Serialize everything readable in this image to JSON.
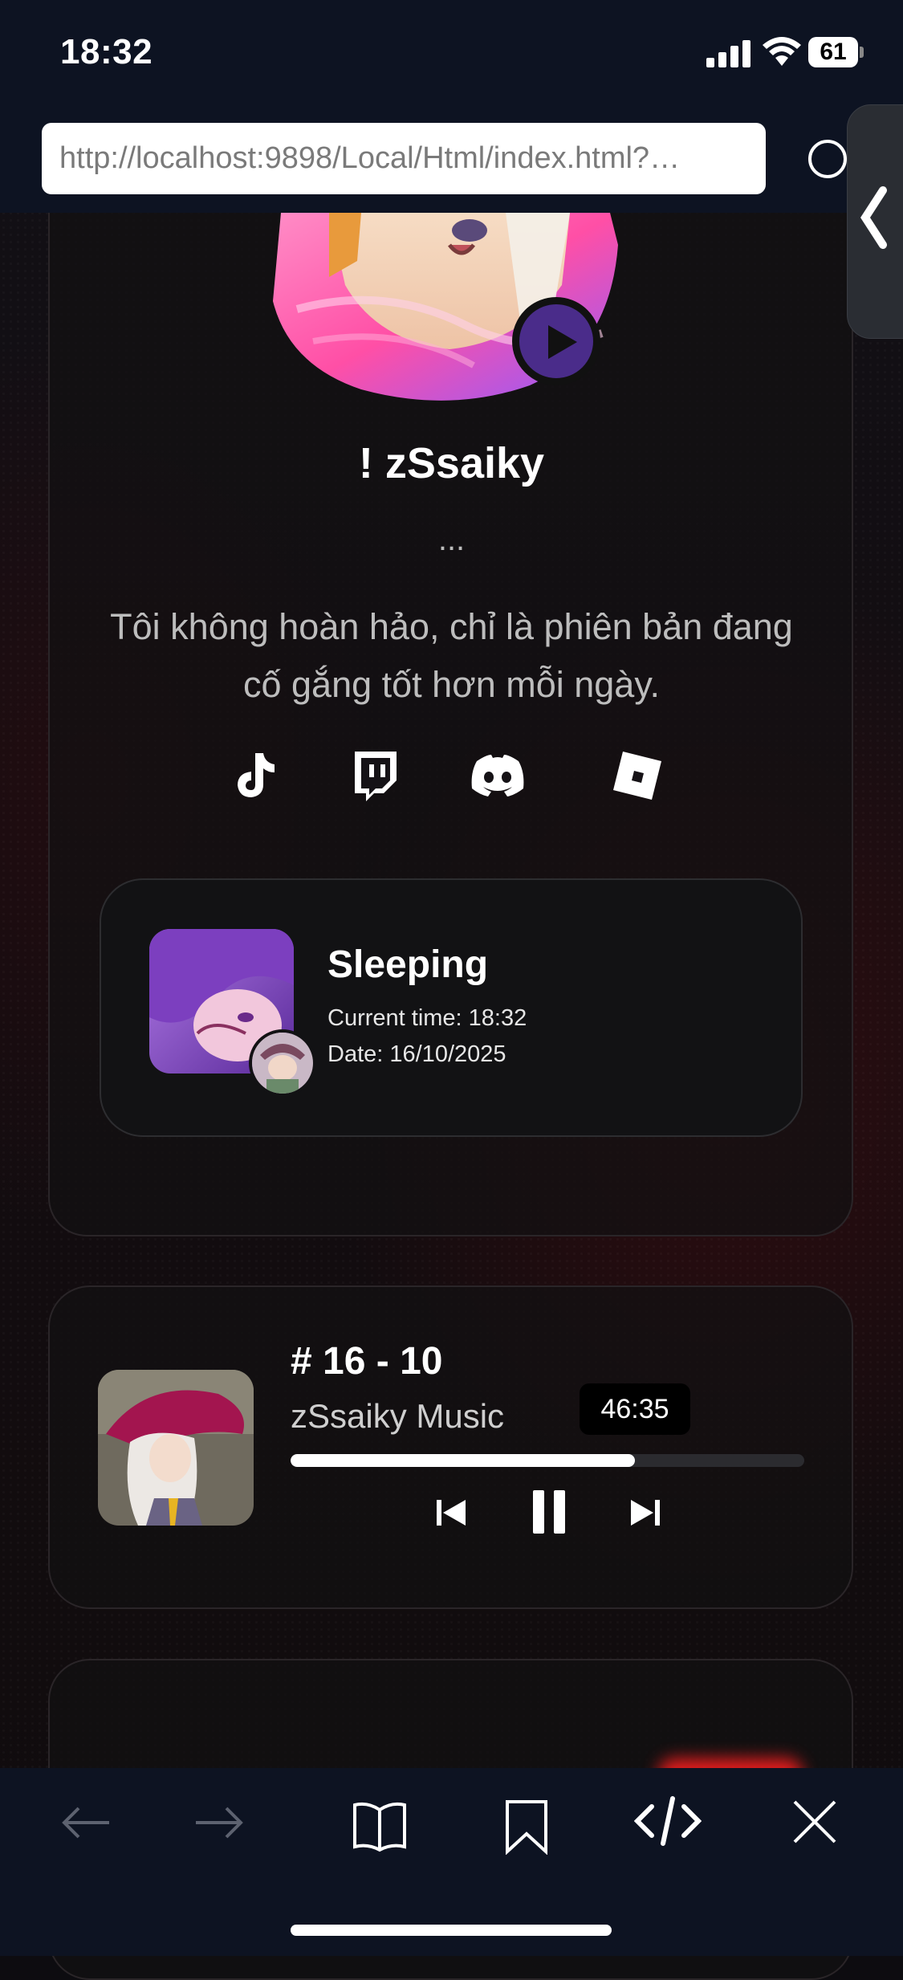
{
  "status_bar": {
    "time": "18:32",
    "battery": "61"
  },
  "browser": {
    "url": "http://localhost:9898/Local/Html/index.html?…"
  },
  "profile": {
    "name": "! zSsaiky",
    "ellipsis": "...",
    "bio": "Tôi không hoàn hảo, chỉ là phiên bản đang cố gắng tốt hơn mỗi ngày.",
    "socials": [
      "tiktok-icon",
      "twitch-icon",
      "discord-icon",
      "roblox-icon"
    ]
  },
  "status_card": {
    "title": "Sleeping",
    "current_time": "Current time: 18:32",
    "date": "Date: 16/10/2025"
  },
  "music": {
    "title": "# 16 - 10",
    "artist": "zSsaiky Music",
    "time_label": "46:35",
    "progress": 0.67
  },
  "toolbar": {
    "icons": [
      "back-arrow-icon",
      "forward-arrow-icon",
      "book-icon",
      "bookmark-icon",
      "code-icon",
      "close-icon"
    ]
  },
  "colors": {
    "accent_play": "#4a2c8a",
    "page_bg": "#0d0c10",
    "bar_bg": "#0d1322"
  }
}
